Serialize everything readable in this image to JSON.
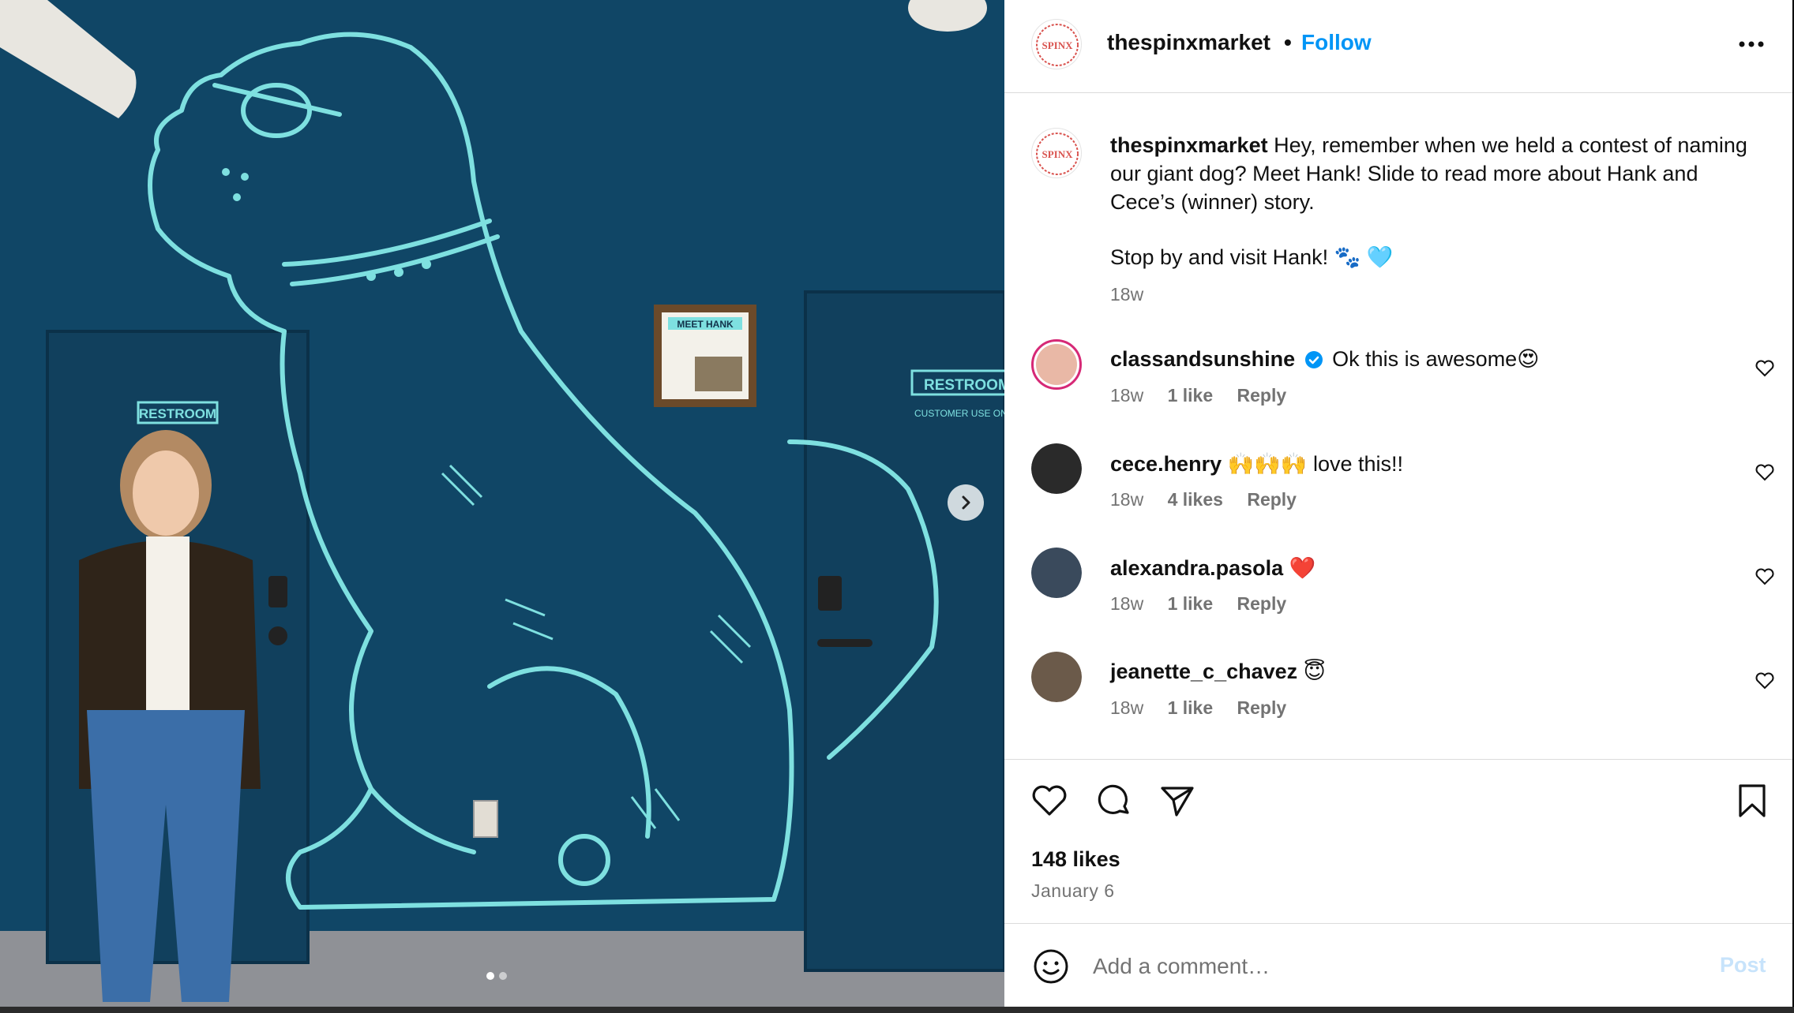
{
  "post": {
    "username": "thespinxmarket",
    "separator": "•",
    "follow_label": "Follow",
    "logo_text": "SPINX",
    "caption_username": "thespinxmarket",
    "caption_text": "Hey, remember when we held a contest of naming our giant dog? Meet Hank! Slide to read more about Hank and Cece’s (winner) story.",
    "caption_line2": "Stop by and visit Hank! 🐾 🩵",
    "caption_time": "18w",
    "photo_sign_meet": "MEET HANK",
    "photo_sign_restroom_left": "RESTROOM",
    "photo_sign_restroom_right": "RESTROOM",
    "photo_sign_customer": "CUSTOMER USE ONLY"
  },
  "comments": [
    {
      "username": "classandsunshine",
      "verified": true,
      "text": "Ok this is awesome😍",
      "time": "18w",
      "likes": "1 like",
      "reply": "Reply",
      "avatar_color": "#e9b8a6"
    },
    {
      "username": "cece.henry",
      "verified": false,
      "text": "🙌🙌🙌 love this!!",
      "time": "18w",
      "likes": "4 likes",
      "reply": "Reply",
      "avatar_color": "#2a2a2a"
    },
    {
      "username": "alexandra.pasola",
      "verified": false,
      "text": "❤️",
      "time": "18w",
      "likes": "1 like",
      "reply": "Reply",
      "avatar_color": "#3a4a5c"
    },
    {
      "username": "jeanette_c_chavez",
      "verified": false,
      "text": "😇",
      "time": "18w",
      "likes": "1 like",
      "reply": "Reply",
      "avatar_color": "#6b5a4a"
    }
  ],
  "footer": {
    "likes": "148 likes",
    "date": "January 6",
    "add_comment_placeholder": "Add a comment…",
    "post_label": "Post"
  },
  "colors": {
    "accent": "#0095f6",
    "mural_line": "#7ee0e0",
    "wall": "#124a6b"
  },
  "icons": [
    "more-icon",
    "heart-icon",
    "comment-icon",
    "share-icon",
    "bookmark-icon",
    "emoji-icon",
    "chevron-right-icon",
    "verified-icon"
  ]
}
